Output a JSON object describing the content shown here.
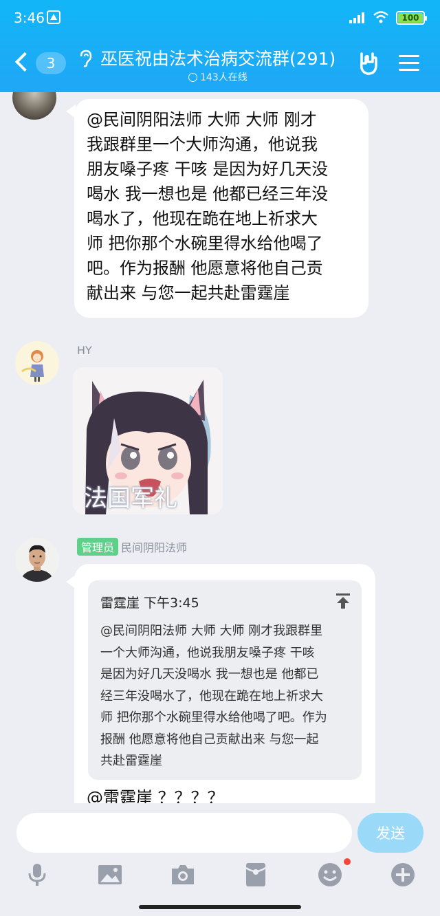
{
  "status_bar": {
    "time": "3:46",
    "battery": "100"
  },
  "header": {
    "back_count": "3",
    "title": "巫医祝由法术治病交流群(291)",
    "online": "143人在线"
  },
  "messages": [
    {
      "text": "@民间阴阳法师 大师 大师 刚才\n我跟群里一个大师沟通，他说我\n朋友嗓子疼 干咳 是因为好几天没\n喝水 我一想也是 他都已经三年没\n喝水了，他现在跪在地上祈求大\n师 把你那个水碗里得水给他喝了\n吧。作为报酬 他愿意将他自己贡\n献出来 与您一起共赴雷霆崖"
    },
    {
      "sender": "HY",
      "sticker_caption": "法国军礼"
    },
    {
      "badge": "管理员",
      "sender": "民间阴阳法师",
      "quote_header": "雷霆崖 下午3:45",
      "quote_text": "@民间阴阳法师 大师 大师 刚才我跟群里\n一个大师沟通，他说我朋友嗓子疼 干咳\n是因为好几天没喝水 我一想也是 他都已\n经三年没喝水了，他现在跪在地上祈求大\n师 把你那个水碗里得水给他喝了吧。作为\n报酬 他愿意将他自己贡献出来 与您一起\n共赴雷霆崖",
      "text": "@雷霆崖 ？？？？"
    }
  ],
  "composer": {
    "placeholder": "",
    "send_label": "发送"
  },
  "colors": {
    "header": "#18b0f7",
    "send": "#9bd9f8",
    "badge": "#5fd08a"
  }
}
